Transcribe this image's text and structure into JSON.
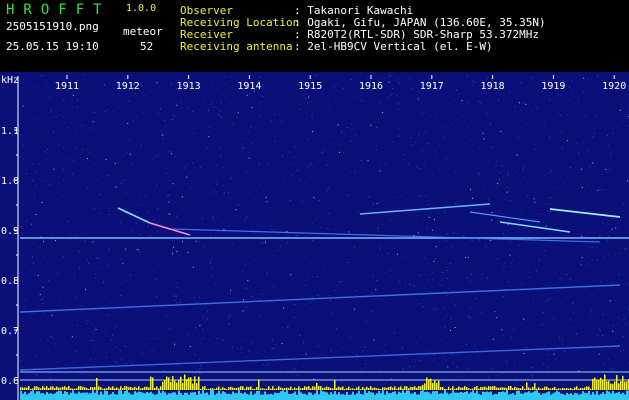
{
  "header": {
    "title": "HROFFT",
    "version": "1.0.0",
    "filename": "2505151910.png",
    "timestamp": "25.05.15 19:10",
    "meteor_label": "meteor",
    "meteor_count": "52",
    "info": [
      {
        "label": "Observer",
        "value": ": Takanori Kawachi"
      },
      {
        "label": "Receiving Location",
        "value": ": Ogaki, Gifu, JAPAN (136.60E, 35.35N)"
      },
      {
        "label": "Receiver",
        "value": ": R820T2(RTL-SDR) SDR-Sharp 53.372MHz"
      },
      {
        "label": "Receiving antenna",
        "value": ": 2el-HB9CV Vertical (el. E-W)"
      }
    ]
  },
  "chart_data": {
    "type": "heatmap",
    "ylabel": "kHz",
    "x_ticks": [
      "1911",
      "1912",
      "1913",
      "1914",
      "1915",
      "1916",
      "1917",
      "1918",
      "1919",
      "1920"
    ],
    "y_ticks": [
      "1.1",
      "1.0",
      "0.9",
      "0.8",
      "0.7",
      "0.6"
    ],
    "ylim": [
      0.6,
      1.15
    ],
    "colors": {
      "background": "#0a0f7a",
      "trace": "#5aa0ff",
      "hot": "#ffffff",
      "level": "#f2f22a",
      "floor": "#30c8f0"
    }
  }
}
